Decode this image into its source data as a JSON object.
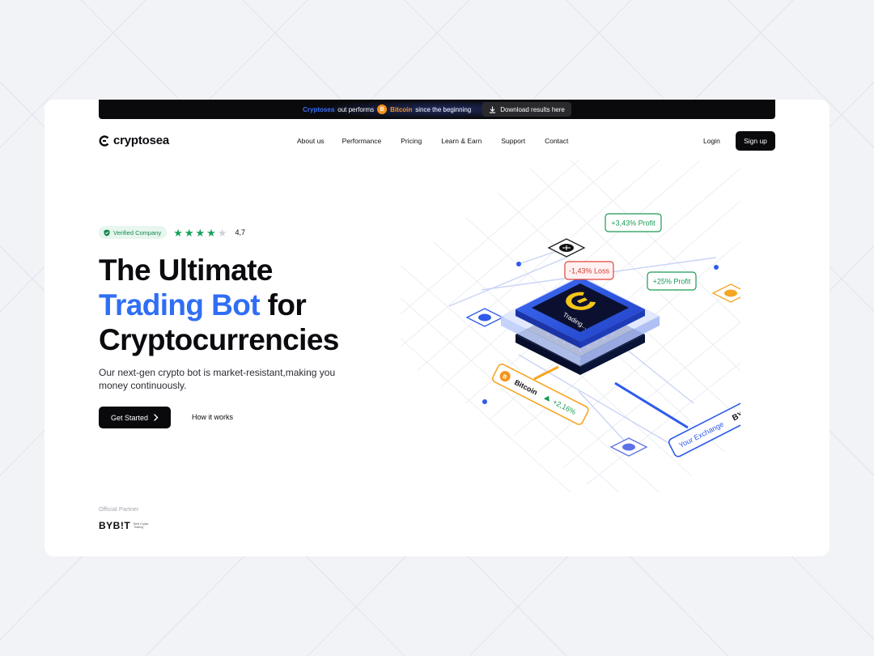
{
  "announcement": {
    "brand": "Cryptosea",
    "text_mid": "out performs",
    "coin_badge": "B",
    "coin": "Bitcoin",
    "text_end": "since the beginning",
    "download_label": "Download results here"
  },
  "nav": {
    "logo_text": "cryptosea",
    "links": [
      "About us",
      "Performance",
      "Pricing",
      "Learn & Earn",
      "Support",
      "Contact"
    ],
    "login": "Login",
    "signup": "Sign up"
  },
  "rating": {
    "verified_label": "Verified Company",
    "stars_filled": 4,
    "stars_total": 5,
    "score": "4,7"
  },
  "hero": {
    "title_line1": "The Ultimate",
    "title_blue": "Trading Bot",
    "title_for": "for",
    "title_line3": "Cryptocurrencies",
    "subtitle": "Our next-gen crypto bot is market-resistant,making you money continuously.",
    "cta_primary": "Get Started",
    "cta_secondary": "How it works"
  },
  "partner": {
    "label": "Official Partner",
    "name": "BYB!T",
    "small_text": "Best Crypto Trading"
  },
  "illustration": {
    "chip_label": "Trading...",
    "tag_profit_1": "+3,43% Profit",
    "tag_loss": "-1,43% Loss",
    "tag_profit_2": "+25% Profit",
    "coin_label": "Bitcoin",
    "coin_change": "+2,16%",
    "coin_badge": "B",
    "exchange_label": "Your Exchange",
    "exchange_name": "BYB!T",
    "accent_blue": "#2f5bea",
    "accent_orange": "#f5a623",
    "profit_green": "#1a9a55",
    "loss_red": "#e0453a"
  },
  "colors": {
    "brand_blue": "#2f6ef5",
    "dark": "#0a0a0c",
    "verified_green": "#18a05a",
    "bitcoin_orange": "#f7931a"
  }
}
